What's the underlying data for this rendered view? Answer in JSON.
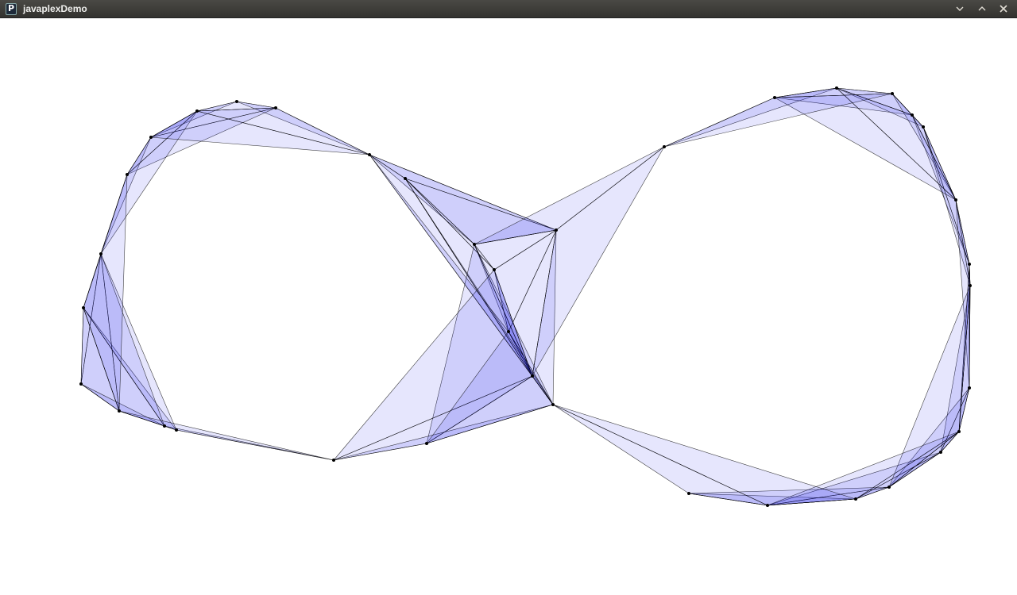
{
  "window": {
    "title": "javaplexDemo",
    "icon": "processing-app-icon",
    "controls": [
      "minimize-icon",
      "maximize-icon",
      "close-icon"
    ]
  },
  "colors": {
    "titlebar": "#3c3b37",
    "title_text": "#eeeeec",
    "background": "#ffffff",
    "fill": "#1a1aee",
    "stroke": "#000000"
  },
  "icon_letter": "P"
}
